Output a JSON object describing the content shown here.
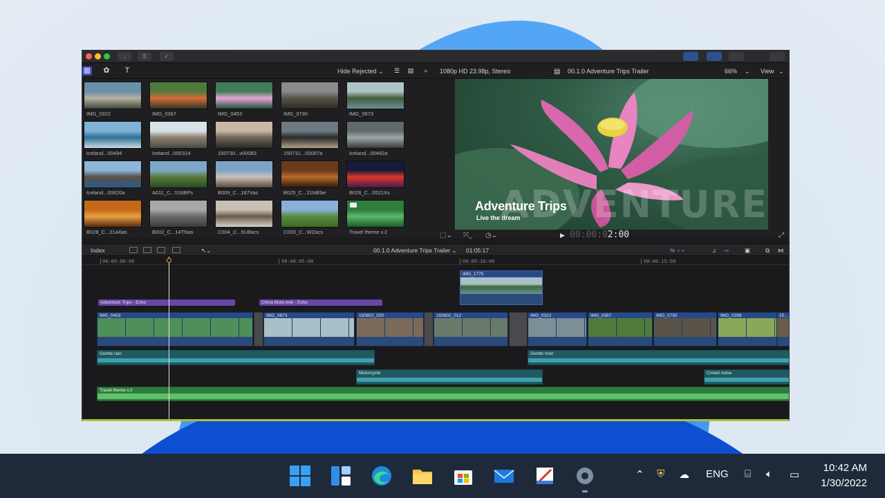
{
  "app": {
    "browser": {
      "filter_label": "Hide Rejected ⌄",
      "clips": [
        {
          "label": "IMG_0322",
          "colors": [
            "#6a8fa8",
            "#b7b1a4",
            "#3f4a3a"
          ]
        },
        {
          "label": "IMG_0367",
          "colors": [
            "#4f7a3b",
            "#d86a3a",
            "#2b3a24"
          ]
        },
        {
          "label": "IMG_0453",
          "colors": [
            "#3f7d58",
            "#e7a6d2",
            "#24503a"
          ]
        },
        {
          "label": "IMG_0730",
          "colors": [
            "#8a8a8a",
            "#5a5448",
            "#2c2a26"
          ]
        },
        {
          "label": "IMG_0873",
          "colors": [
            "#aec4c8",
            "#3f5f3a",
            "#6d8f9a"
          ]
        },
        {
          "label": "Iceland...00494",
          "colors": [
            "#7fb3d6",
            "#2f6f96",
            "#c9dbe4"
          ]
        },
        {
          "label": "Iceland...000314",
          "colors": [
            "#d9e2e6",
            "#8a7f70",
            "#4a4a42"
          ]
        },
        {
          "label": "150730...v00083",
          "colors": [
            "#c7b9a6",
            "#6f6458",
            "#2f2a26"
          ]
        },
        {
          "label": "150731...00087a",
          "colors": [
            "#6d7a84",
            "#2a2a2a",
            "#b0a08c"
          ]
        },
        {
          "label": "Iceland...00462a",
          "colors": [
            "#5f6a6a",
            "#9fa9a8",
            "#3a3a3a"
          ]
        },
        {
          "label": "Iceland...00620a",
          "colors": [
            "#8eb6d9",
            "#5a4f48",
            "#2a5a8a"
          ]
        },
        {
          "label": "A011_C...516BPs",
          "colors": [
            "#7da7c8",
            "#5a7a3a",
            "#2a4a2a"
          ]
        },
        {
          "label": "B009_C...187Vas",
          "colors": [
            "#7fa3c6",
            "#c8c2b8",
            "#5c4a3c"
          ]
        },
        {
          "label": "B025_C...21MEbe",
          "colors": [
            "#6a3a1e",
            "#b86a2a",
            "#2a1a10"
          ]
        },
        {
          "label": "B026_C...0521Xs",
          "colors": [
            "#1a1a3a",
            "#d83a2a",
            "#4a1a4a"
          ]
        },
        {
          "label": "B028_C...21A6as",
          "colors": [
            "#c26a1a",
            "#e8a040",
            "#5a2a10"
          ]
        },
        {
          "label": "B002_C...14TNas",
          "colors": [
            "#a8a8a8",
            "#6a6a6a",
            "#3a3a3a"
          ]
        },
        {
          "label": "C004_C...5U8acs",
          "colors": [
            "#c8c0b4",
            "#6a5a4a",
            "#d8d2c8"
          ]
        },
        {
          "label": "C003_C...WZacs",
          "colors": [
            "#8ab0d8",
            "#5a8a3a",
            "#3a6a2a"
          ]
        },
        {
          "label": "Travel theme v.2",
          "colors": [
            "#2e7d3a",
            "#5ab86a",
            "#1e5a28"
          ],
          "audio": true
        }
      ]
    },
    "viewer": {
      "format": "1080p HD 23.98p, Stereo",
      "project_name": "00.1.0 Adventure Trips Trailer",
      "zoom": "66%",
      "view_label": "View",
      "title_text": "Adventure Trips",
      "subtitle_text": "Live the dream",
      "watermark_text": "ADVENTURE TRIPS",
      "timecode_dim": "00:00:0",
      "timecode_bright": "2:00"
    },
    "timeline_bar": {
      "index_label": "Index",
      "project_label": "00.1.0 Adventure Trips Trailer ⌄",
      "duration": "01:05:17"
    },
    "timeline": {
      "ruler": [
        "00:00:00:00",
        "00:00:05:00",
        "00:00:10:00",
        "00:00:15:00"
      ],
      "connected_clip": "IMG_1775",
      "titles": [
        {
          "label": "Adventure Trips - Echo"
        },
        {
          "label": "China Moto-trek - Echo"
        }
      ],
      "primary": [
        {
          "label": "IMG_0453",
          "color": "#4f8f5a"
        },
        {
          "label": "IMG_0873",
          "color": "#a8c0c8"
        },
        {
          "label": "150802_020",
          "color": "#7a6a5a"
        },
        {
          "label": "150802_012",
          "color": "#6a7a6a"
        },
        {
          "label": "IMG_0322",
          "color": "#7a8f96"
        },
        {
          "label": "IMG_0367",
          "color": "#4f7a3b"
        },
        {
          "label": "IMG_0730",
          "color": "#5a5448"
        },
        {
          "label": "IMG_0298",
          "color": "#8aa85a"
        },
        {
          "label": "15...",
          "color": "#6a5a4a"
        }
      ],
      "audio": [
        {
          "label": "Gentle rain"
        },
        {
          "label": "Gentle river"
        },
        {
          "label": "Motorcycle"
        },
        {
          "label": "Crowd noise"
        }
      ],
      "music": "Travel theme v.2"
    }
  },
  "taskbar": {
    "icons": [
      "windows-start-icon",
      "widgets-icon",
      "edge-browser-icon",
      "file-explorer-icon",
      "microsoft-store-icon",
      "mail-icon",
      "paint-icon",
      "settings-icon"
    ],
    "language": "ENG",
    "time": "10:42 AM",
    "date": "1/30/2022"
  }
}
